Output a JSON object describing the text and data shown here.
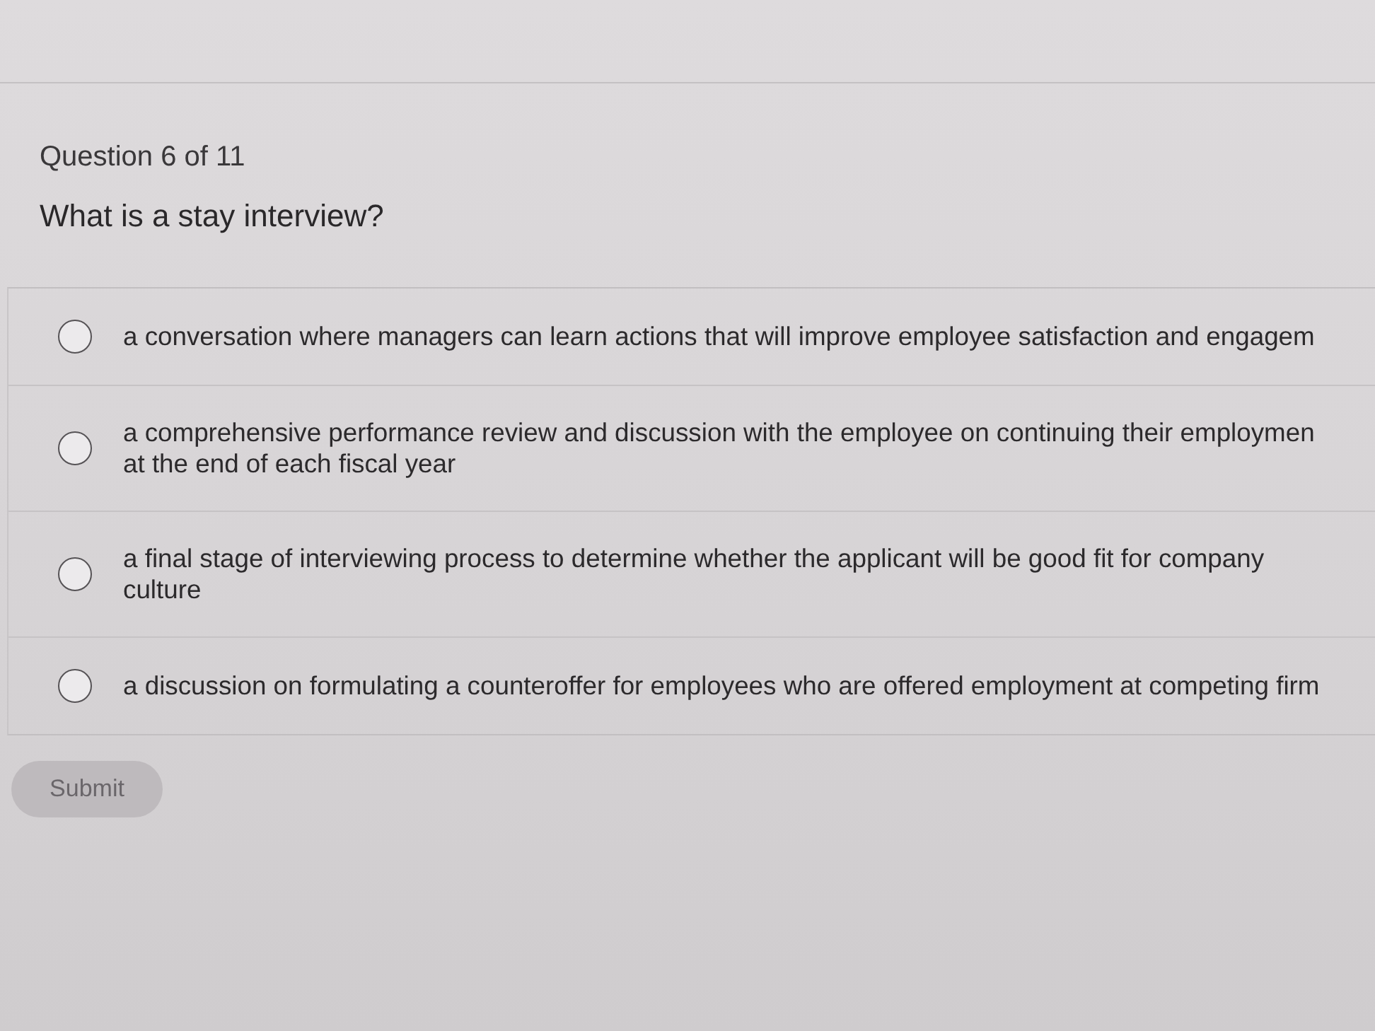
{
  "quiz": {
    "progress": "Question 6 of 11",
    "question": "What is a stay interview?"
  },
  "options": [
    {
      "lines": [
        "a conversation where managers can learn actions that will improve employee satisfaction and engagem"
      ],
      "selected": false
    },
    {
      "lines": [
        "a comprehensive performance review and discussion with the employee on continuing their employmen",
        "at the end of each fiscal year"
      ],
      "selected": false
    },
    {
      "lines": [
        "a final stage of interviewing process to determine whether the applicant will be good fit for company",
        "culture"
      ],
      "selected": false
    },
    {
      "lines": [
        "a discussion on formulating a counteroffer for employees who are offered employment at competing firm"
      ],
      "selected": false
    }
  ],
  "submit": {
    "label": "Submit",
    "disabled": true
  }
}
